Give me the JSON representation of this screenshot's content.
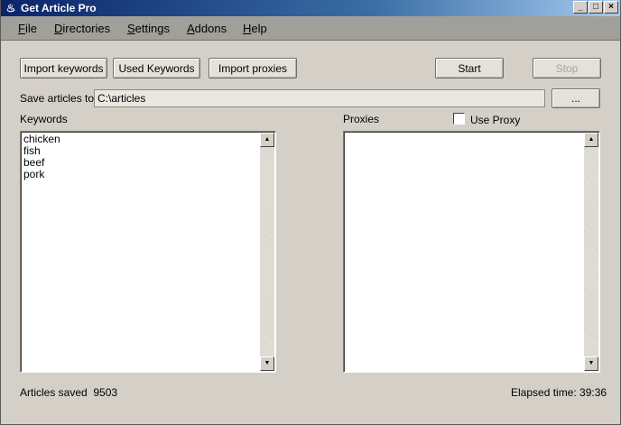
{
  "window": {
    "title": "Get Article Pro",
    "controls": {
      "minimize": "_",
      "maximize": "□",
      "close": "×"
    }
  },
  "menu": [
    {
      "accel": "F",
      "rest": "ile"
    },
    {
      "accel": "D",
      "rest": "irectories"
    },
    {
      "accel": "S",
      "rest": "ettings"
    },
    {
      "accel": "A",
      "rest": "ddons"
    },
    {
      "accel": "H",
      "rest": "elp"
    }
  ],
  "toolbar": {
    "import_keywords": "Import keywords",
    "used_keywords": "Used Keywords",
    "import_proxies": "Import proxies",
    "start": "Start",
    "stop": "Stop"
  },
  "save": {
    "label": "Save articles to",
    "path": "C:\\articles",
    "browse": "..."
  },
  "keywords": {
    "label": "Keywords",
    "items": [
      "chicken",
      "fish",
      "beef",
      "pork"
    ]
  },
  "proxies": {
    "label": "Proxies",
    "use_proxy_label": "Use Proxy",
    "use_proxy_checked": false
  },
  "status": {
    "articles_saved_label": "Articles saved",
    "articles_saved_value": "9503",
    "elapsed_label": "Elapsed time:",
    "elapsed_value": "39:36"
  }
}
